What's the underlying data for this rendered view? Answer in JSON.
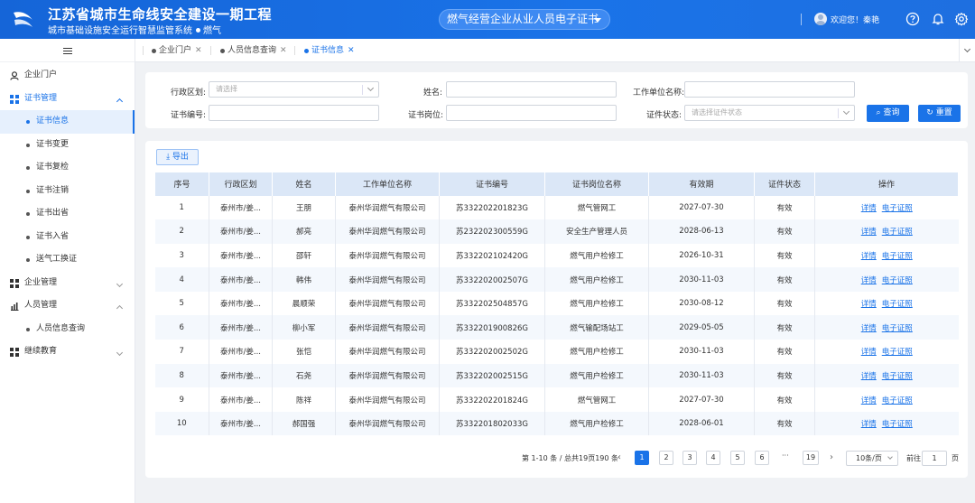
{
  "header": {
    "title": "江苏省城市生命线安全建设一期工程",
    "subtitle": "城市基础设施安全运行智慧监管系统",
    "module": "燃气",
    "system_select": "燃气经营企业从业人员电子证书",
    "welcome": "欢迎您！秦艳",
    "icons": [
      "help-icon",
      "bell-icon",
      "settings-icon"
    ]
  },
  "sidebar": {
    "items": [
      {
        "label": "企业门户",
        "icon": "person-icon"
      },
      {
        "label": "证书管理",
        "icon": "grid-icon",
        "open": true,
        "children": [
          "证书信息",
          "证书变更",
          "证书复检",
          "证书注销",
          "证书出省",
          "证书入省",
          "送气工换证"
        ]
      },
      {
        "label": "企业管理",
        "icon": "grid-icon"
      },
      {
        "label": "人员管理",
        "icon": "chart-icon",
        "children": [
          "人员信息查询"
        ]
      },
      {
        "label": "继续教育",
        "icon": "grid-icon"
      }
    ]
  },
  "tabs": [
    {
      "label": "企业门户",
      "active": false
    },
    {
      "label": "人员信息查询",
      "active": false
    },
    {
      "label": "证书信息",
      "active": true
    }
  ],
  "filter": {
    "region_label": "行政区划:",
    "region_placeholder": "请选择",
    "name_label": "姓名:",
    "company_label": "工作单位名称:",
    "cert_no_label": "证书编号:",
    "position_label": "证书岗位:",
    "status_label": "证件状态:",
    "status_placeholder": "请选择证件状态",
    "query_btn": "查询",
    "reset_btn": "重置"
  },
  "table": {
    "export_btn": "导出",
    "columns": [
      "序号",
      "行政区划",
      "姓名",
      "工作单位名称",
      "证书编号",
      "证书岗位名称",
      "有效期",
      "证件状态",
      "操作"
    ],
    "rows": [
      [
        "1",
        "泰州市/姜...",
        "王朋",
        "泰州华润燃气有限公司",
        "苏332202201823G",
        "燃气管网工",
        "2027-07-30",
        "有效"
      ],
      [
        "2",
        "泰州市/姜...",
        "郝亮",
        "泰州华润燃气有限公司",
        "苏232202300559G",
        "安全生产管理人员",
        "2028-06-13",
        "有效"
      ],
      [
        "3",
        "泰州市/姜...",
        "邵轩",
        "泰州华润燃气有限公司",
        "苏332202102420G",
        "燃气用户检修工",
        "2026-10-31",
        "有效"
      ],
      [
        "4",
        "泰州市/姜...",
        "韩伟",
        "泰州华润燃气有限公司",
        "苏332202002507G",
        "燃气用户检修工",
        "2030-11-03",
        "有效"
      ],
      [
        "5",
        "泰州市/姜...",
        "晨顺荣",
        "泰州华润燃气有限公司",
        "苏332202504857G",
        "燃气用户检修工",
        "2030-08-12",
        "有效"
      ],
      [
        "6",
        "泰州市/姜...",
        "柳小军",
        "泰州华润燃气有限公司",
        "苏332201900826G",
        "燃气输配场站工",
        "2029-05-05",
        "有效"
      ],
      [
        "7",
        "泰州市/姜...",
        "张恺",
        "泰州华润燃气有限公司",
        "苏332202002502G",
        "燃气用户检修工",
        "2030-11-03",
        "有效"
      ],
      [
        "8",
        "泰州市/姜...",
        "石尧",
        "泰州华润燃气有限公司",
        "苏332202002515G",
        "燃气用户检修工",
        "2030-11-03",
        "有效"
      ],
      [
        "9",
        "泰州市/姜...",
        "陈祥",
        "泰州华润燃气有限公司",
        "苏332202201824G",
        "燃气管网工",
        "2027-07-30",
        "有效"
      ],
      [
        "10",
        "泰州市/姜...",
        "郝国强",
        "泰州华润燃气有限公司",
        "苏332201802033G",
        "燃气用户检修工",
        "2028-06-01",
        "有效"
      ]
    ],
    "op_detail": "详情",
    "op_cert": "电子证照"
  },
  "pager": {
    "summary": "第 1-10 条 / 总共19页190 条",
    "pages": [
      "1",
      "2",
      "3",
      "4",
      "5",
      "6"
    ],
    "ellipsis": "···",
    "last_page": "19",
    "page_size": "10条/页",
    "goto_label": "前往",
    "goto_value": "1",
    "page_suffix": "页"
  },
  "colors": {
    "primary": "#1a73e8",
    "header": "#1565d8",
    "table_header": "#dbe7f7"
  }
}
